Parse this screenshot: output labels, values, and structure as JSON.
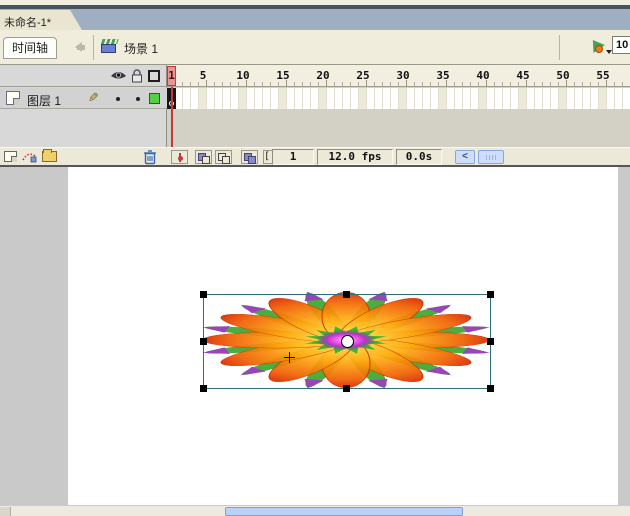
{
  "tab": {
    "title": "未命名-1*"
  },
  "edit_bar": {
    "timeline_button": "时间轴",
    "scene_label": "场景 1",
    "zoom_value": "10"
  },
  "timeline": {
    "layer_name": "图层 1",
    "ruler_numbers": [
      "1",
      "5",
      "10",
      "15",
      "20",
      "25",
      "30",
      "35",
      "40",
      "45",
      "50",
      "55"
    ],
    "frame_count": 58,
    "current_frame": "1",
    "frame_rate": "12.0 fps",
    "elapsed_time": "0.0s"
  },
  "icons": {
    "pencil": "✎",
    "modify_onion_markers": "[·]",
    "scroll_left_arrow": "<"
  },
  "colors": {
    "accent_band": "#9fafc1",
    "panel_cream": "#ece9d8",
    "playhead_red": "#c03a3a",
    "selection_teal": "#2e6f7d",
    "layer_outline_swatch": "#55cf45",
    "scroll_thumb_blue": "#b9d1f8"
  }
}
